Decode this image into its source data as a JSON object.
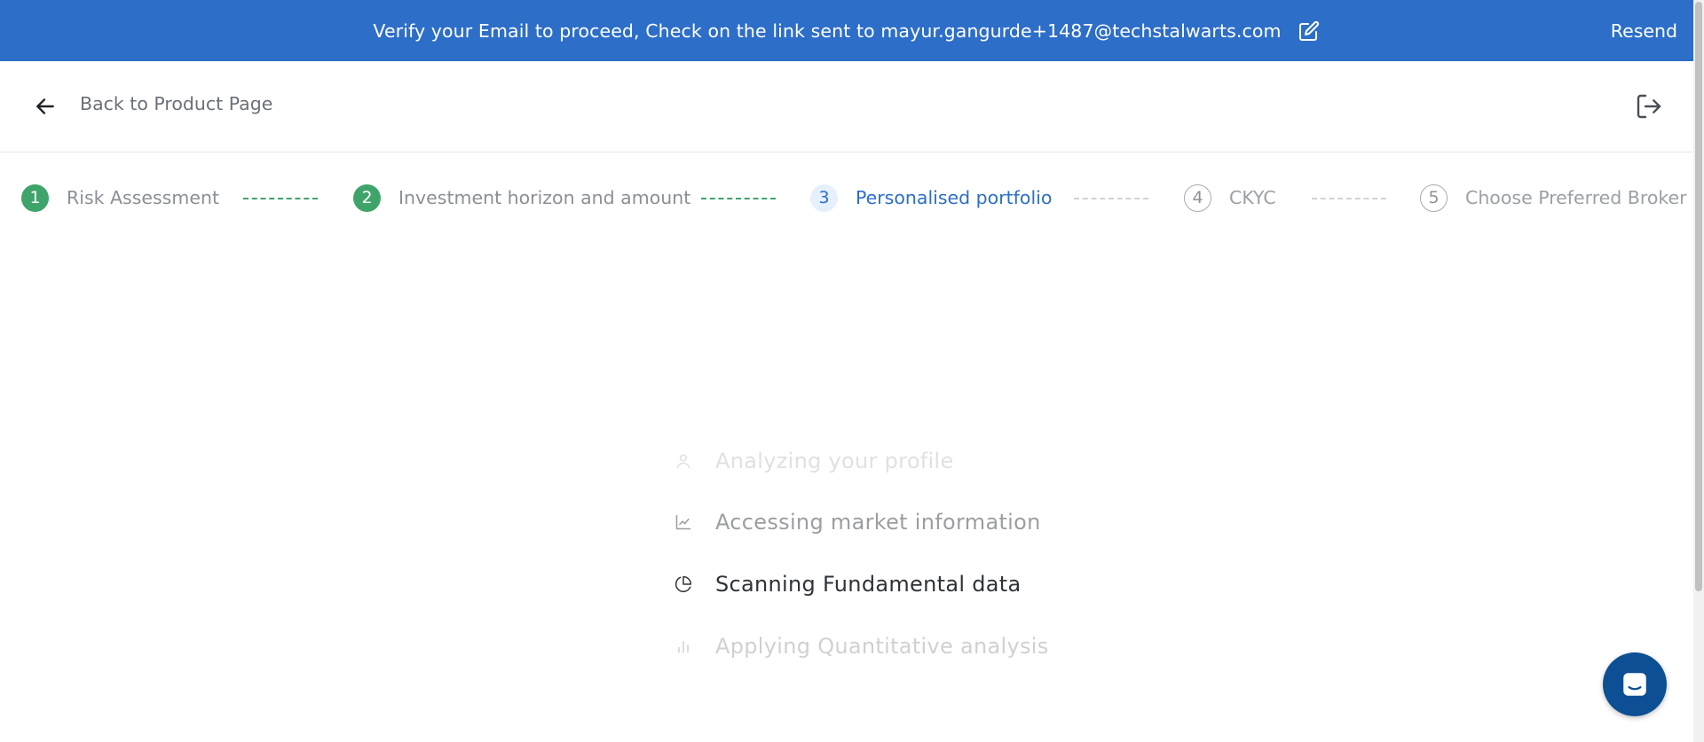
{
  "banner": {
    "message": "Verify your Email to proceed, Check on the link sent to mayur.gangurde+1487@techstalwarts.com",
    "resend_label": "Resend",
    "background": "#2d6ec8"
  },
  "header": {
    "back_label": "Back to Product Page",
    "back_icon": "arrow-left-icon",
    "logout_icon": "logout-icon"
  },
  "stepper": {
    "steps": [
      {
        "number": "1",
        "label": "Risk Assessment",
        "state": "done"
      },
      {
        "number": "2",
        "label": "Investment horizon and amount",
        "state": "done"
      },
      {
        "number": "3",
        "label": "Personalised portfolio",
        "state": "active"
      },
      {
        "number": "4",
        "label": "CKYC",
        "state": "pending"
      },
      {
        "number": "5",
        "label": "Choose Preferred Broker",
        "state": "pending"
      }
    ],
    "done_color": "#3fa46a",
    "active_color": "#2d6ec8"
  },
  "loading": {
    "items": [
      {
        "label": "Analyzing your profile",
        "icon": "user-icon"
      },
      {
        "label": "Accessing market information",
        "icon": "line-chart-icon"
      },
      {
        "label": "Scanning Fundamental data",
        "icon": "pie-chart-icon"
      },
      {
        "label": "Applying Quantitative analysis",
        "icon": "bar-chart-icon"
      }
    ]
  },
  "chat": {
    "icon": "chat-icon"
  }
}
